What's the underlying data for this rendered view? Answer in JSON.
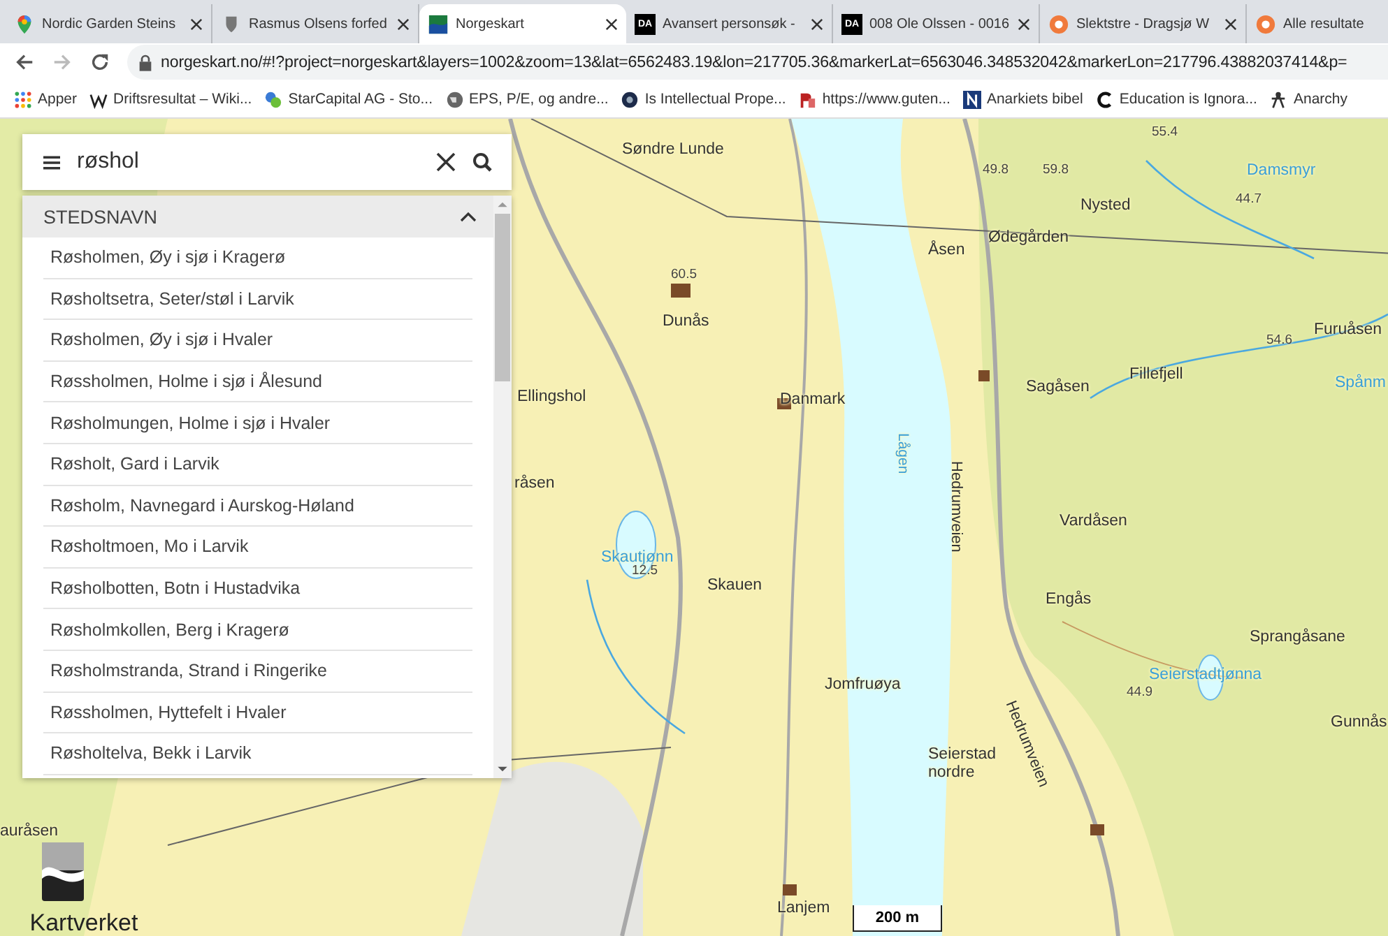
{
  "browser": {
    "tabs": [
      {
        "title": "Nordic Garden Steins",
        "kind": "pin",
        "selected": false
      },
      {
        "title": "Rasmus Olsens forfed",
        "kind": "crest",
        "selected": false
      },
      {
        "title": "Norgeskart",
        "kind": "flag",
        "selected": true
      },
      {
        "title": "Avansert personsøk -",
        "kind": "da",
        "badge": "DA",
        "selected": false
      },
      {
        "title": "008 Ole Olssen - 0016",
        "kind": "da",
        "badge": "DA",
        "selected": false
      },
      {
        "title": "Slektstre - Dragsjø W",
        "kind": "orange",
        "selected": false
      },
      {
        "title": "Alle resultate",
        "kind": "orange",
        "selected": false
      }
    ],
    "address": "norgeskart.no/#!?project=norgeskart&layers=1002&zoom=13&lat=6562483.19&lon=217705.36&markerLat=6563046.348532042&markerLon=217796.43882037414&p=",
    "bookmarks": [
      {
        "title": "Apper",
        "kind": "apps"
      },
      {
        "title": "Driftsresultat – Wiki...",
        "kind": "wiki"
      },
      {
        "title": "StarCapital AG - Sto...",
        "kind": "star"
      },
      {
        "title": "EPS, P/E, og andre...",
        "kind": "globe"
      },
      {
        "title": "Is Intellectual Prope...",
        "kind": "dark"
      },
      {
        "title": "https://www.guten...",
        "kind": "pg"
      },
      {
        "title": "Anarkiets bibel",
        "kind": "n"
      },
      {
        "title": "Education is Ignora...",
        "kind": "c"
      },
      {
        "title": "Anarchy",
        "kind": "figure"
      }
    ]
  },
  "search": {
    "value": "røshol",
    "group": {
      "title": "STEDSNAVN",
      "expanded": true,
      "results": [
        "Røsholmen, Øy i sjø i Kragerø",
        "Røsholtsetra, Seter/støl i Larvik",
        "Røsholmen, Øy i sjø i Hvaler",
        "Røssholmen, Holme i sjø i Ålesund",
        "Røsholmungen, Holme i sjø i Hvaler",
        "Røsholt, Gard i Larvik",
        "Røsholm, Navnegard i Aurskog-Høland",
        "Røsholtmoen, Mo i Larvik",
        "Røsholbotten, Botn i Hustadvika",
        "Røsholmkollen, Berg i Kragerø",
        "Røsholmstranda, Strand i Ringerike",
        "Røssholmen, Hyttefelt i Hvaler",
        "Røsholtelva, Bekk i Larvik"
      ]
    }
  },
  "map": {
    "labels": [
      {
        "text": "Søndre Lunde",
        "kind": "place"
      },
      {
        "text": "55.4",
        "kind": "height"
      },
      {
        "text": "49.8",
        "kind": "height"
      },
      {
        "text": "59.8",
        "kind": "height"
      },
      {
        "text": "Damsmyr",
        "kind": "water"
      },
      {
        "text": "Nysted",
        "kind": "place"
      },
      {
        "text": "44.7",
        "kind": "height"
      },
      {
        "text": "Ødegården",
        "kind": "place"
      },
      {
        "text": "Åsen",
        "kind": "place"
      },
      {
        "text": "60.5",
        "kind": "height"
      },
      {
        "text": "Dunås",
        "kind": "place"
      },
      {
        "text": "Furuåsen",
        "kind": "place"
      },
      {
        "text": "54.6",
        "kind": "height"
      },
      {
        "text": "Spånm",
        "kind": "water"
      },
      {
        "text": "Ellingshol",
        "kind": "place"
      },
      {
        "text": "Danmark",
        "kind": "place"
      },
      {
        "text": "Sagåsen",
        "kind": "place"
      },
      {
        "text": "Fillefjell",
        "kind": "place"
      },
      {
        "text": "Lågen",
        "kind": "river"
      },
      {
        "text": "Hedrumveien",
        "kind": "road"
      },
      {
        "text": "råsen",
        "kind": "place"
      },
      {
        "text": "Vardåsen",
        "kind": "place"
      },
      {
        "text": "Skautjønn",
        "kind": "water"
      },
      {
        "text": "12.5",
        "kind": "height"
      },
      {
        "text": "Skauen",
        "kind": "place"
      },
      {
        "text": "Engås",
        "kind": "place"
      },
      {
        "text": "Sprangåsane",
        "kind": "place"
      },
      {
        "text": "Seierstadtjønna",
        "kind": "water"
      },
      {
        "text": "44.9",
        "kind": "height"
      },
      {
        "text": "Jomfruøya",
        "kind": "place"
      },
      {
        "text": "Gunnås",
        "kind": "place"
      },
      {
        "text": "Seierstad nordre",
        "kind": "place"
      },
      {
        "text": "Hedrumveien",
        "kind": "road2"
      },
      {
        "text": "Lanjem",
        "kind": "place"
      },
      {
        "text": "auråsen",
        "kind": "place"
      }
    ],
    "scale": "200 m"
  },
  "logo": "Kartverket"
}
